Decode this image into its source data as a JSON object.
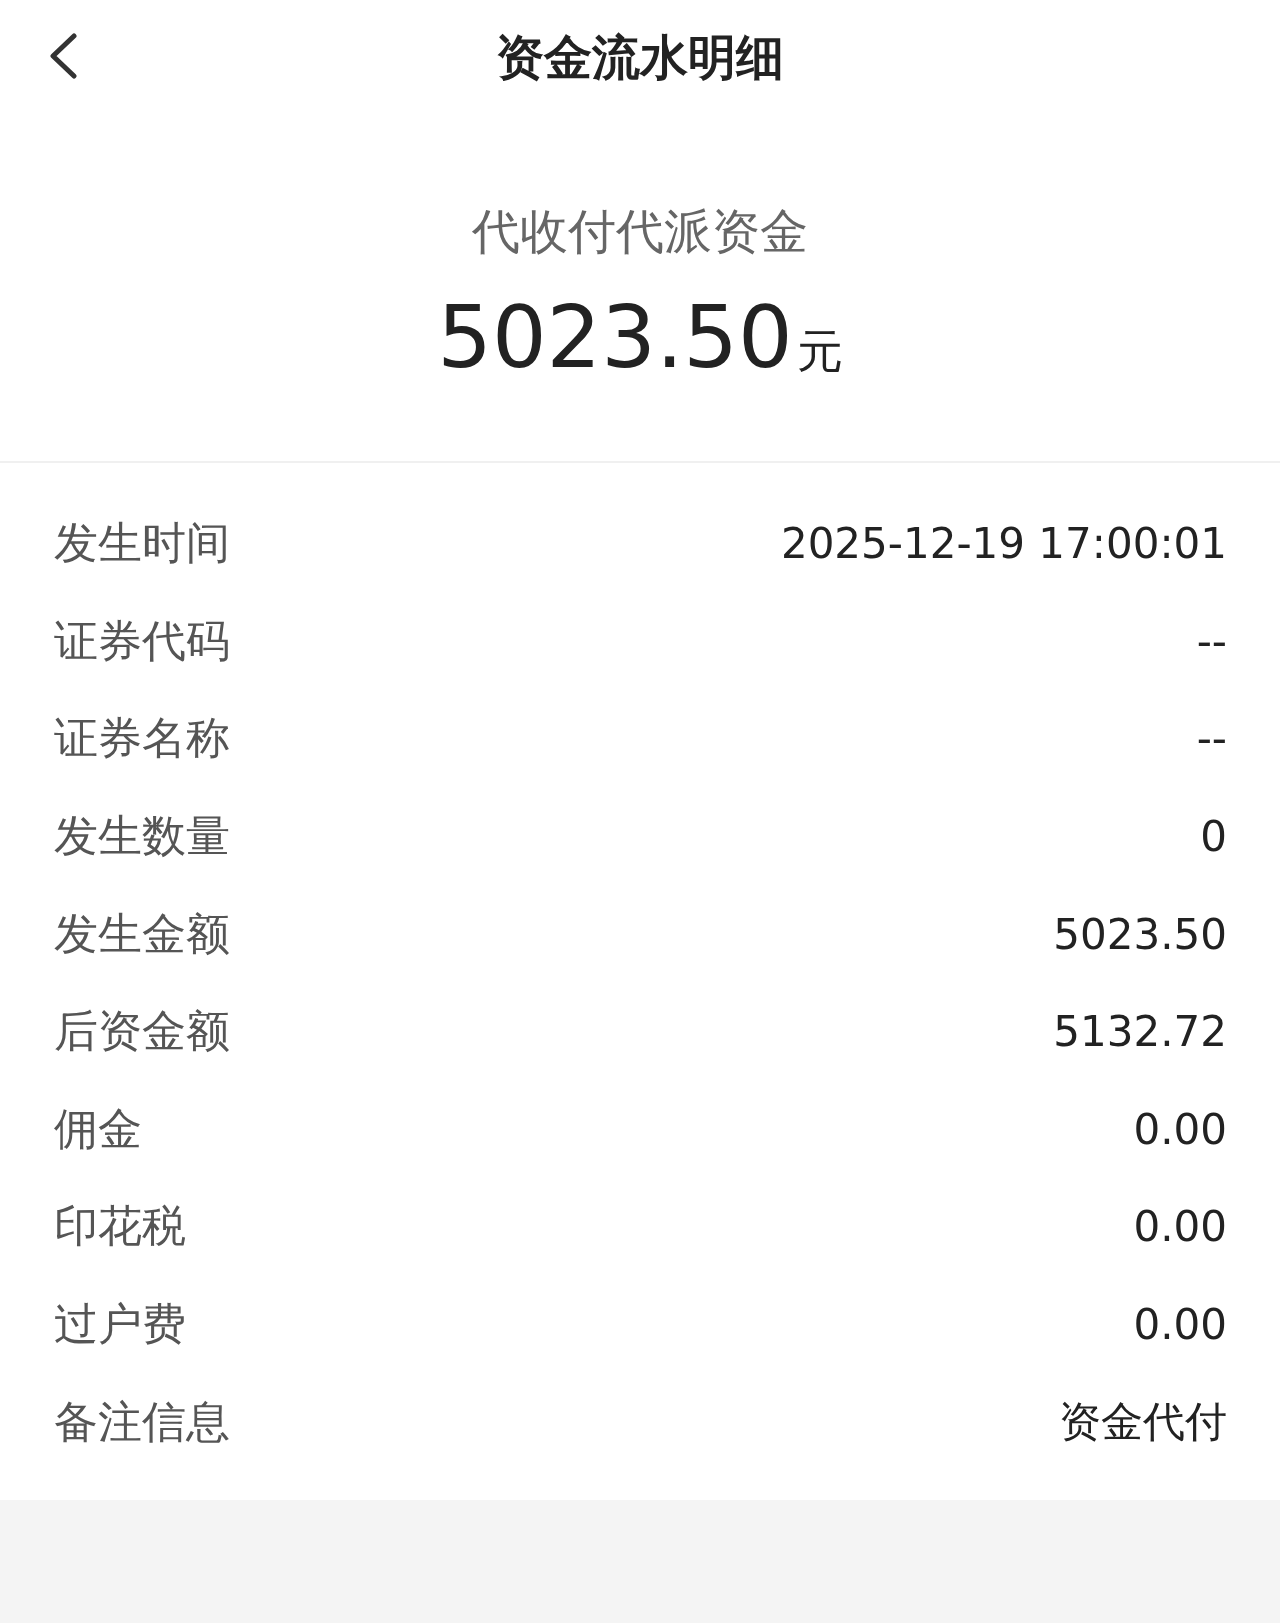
{
  "header": {
    "title": "资金流水明细"
  },
  "summary": {
    "type": "代收付代派资金",
    "amount": "5023.50",
    "unit": "元"
  },
  "details": [
    {
      "label": "发生时间",
      "value": "2025-12-19 17:00:01"
    },
    {
      "label": "证券代码",
      "value": "--"
    },
    {
      "label": "证券名称",
      "value": "--"
    },
    {
      "label": "发生数量",
      "value": "0"
    },
    {
      "label": "发生金额",
      "value": "5023.50"
    },
    {
      "label": "后资金额",
      "value": "5132.72"
    },
    {
      "label": "佣金",
      "value": "0.00"
    },
    {
      "label": "印花税",
      "value": "0.00"
    },
    {
      "label": "过户费",
      "value": "0.00"
    },
    {
      "label": "备注信息",
      "value": "资金代付"
    }
  ]
}
